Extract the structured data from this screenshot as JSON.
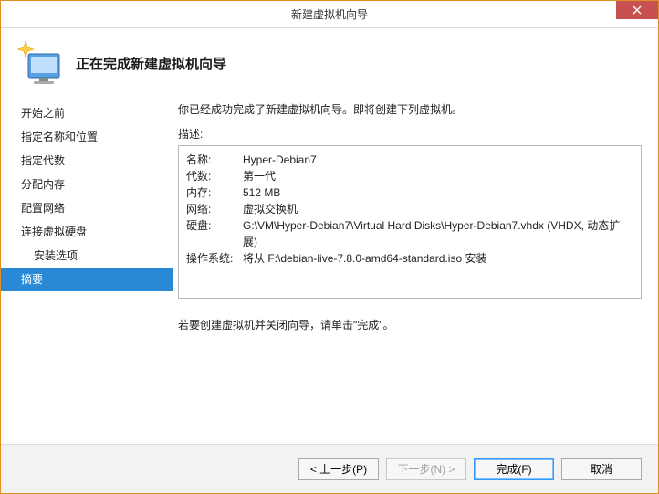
{
  "window": {
    "title": "新建虚拟机向导"
  },
  "header": {
    "heading": "正在完成新建虚拟机向导"
  },
  "sidebar": {
    "items": [
      {
        "label": "开始之前",
        "indent": false,
        "selected": false
      },
      {
        "label": "指定名称和位置",
        "indent": false,
        "selected": false
      },
      {
        "label": "指定代数",
        "indent": false,
        "selected": false
      },
      {
        "label": "分配内存",
        "indent": false,
        "selected": false
      },
      {
        "label": "配置网络",
        "indent": false,
        "selected": false
      },
      {
        "label": "连接虚拟硬盘",
        "indent": false,
        "selected": false
      },
      {
        "label": "安装选项",
        "indent": true,
        "selected": false
      },
      {
        "label": "摘要",
        "indent": false,
        "selected": true
      }
    ]
  },
  "content": {
    "intro": "你已经成功完成了新建虚拟机向导。即将创建下列虚拟机。",
    "desc_label": "描述:",
    "rows": [
      {
        "key": "名称:",
        "value": "Hyper-Debian7"
      },
      {
        "key": "代数:",
        "value": "第一代"
      },
      {
        "key": "内存:",
        "value": "512 MB"
      },
      {
        "key": "网络:",
        "value": "虚拟交换机"
      },
      {
        "key": "硬盘:",
        "value": "G:\\VM\\Hyper-Debian7\\Virtual Hard Disks\\Hyper-Debian7.vhdx (VHDX, 动态扩展)"
      },
      {
        "key": "操作系统:",
        "value": "将从 F:\\debian-live-7.8.0-amd64-standard.iso 安装"
      }
    ],
    "footnote": "若要创建虚拟机并关闭向导，请单击\"完成\"。"
  },
  "footer": {
    "previous": "< 上一步(P)",
    "next": "下一步(N) >",
    "finish": "完成(F)",
    "cancel": "取消"
  }
}
